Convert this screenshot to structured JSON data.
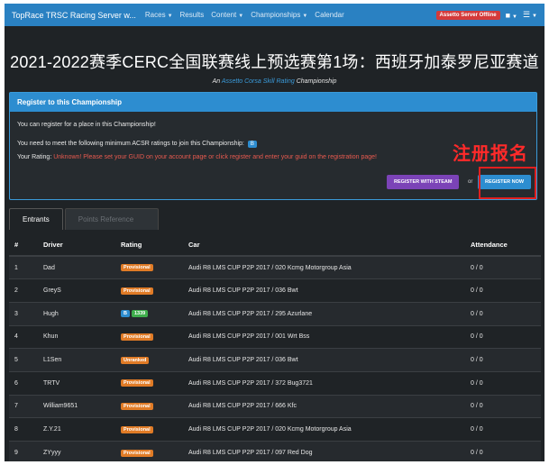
{
  "navbar": {
    "brand": "TopRace TRSC Racing Server w...",
    "items": [
      {
        "label": "Races",
        "dropdown": true
      },
      {
        "label": "Results",
        "dropdown": false
      },
      {
        "label": "Content",
        "dropdown": true
      },
      {
        "label": "Championships",
        "dropdown": true
      },
      {
        "label": "Calendar",
        "dropdown": false
      }
    ],
    "server_status": "Assetto Server Offline",
    "user_icon": "user-icon",
    "menu_icon": "menu-icon"
  },
  "page": {
    "title": "2021-2022赛季CERC全国联赛线上预选赛第1场：西班牙加泰罗尼亚赛道",
    "subtitle_prefix": "An",
    "subtitle_link": "Assetto Corsa Skill Rating",
    "subtitle_suffix": "Championship"
  },
  "register_panel": {
    "heading": "Register to this Championship",
    "line1": "You can register for a place in this Championship!",
    "line2": "You need to meet the following minimum ACSR ratings to join this Championship:",
    "required_rating": "B",
    "your_rating_label": "Your Rating:",
    "your_rating_warning": "Unknown! Please set your GUID on your account page or click register and enter your guid on the registration page!",
    "steam_button": "REGISTER WITH STEAM",
    "or_text": "or",
    "register_button": "REGISTER NOW"
  },
  "annotation": {
    "text": "注册报名",
    "color": "#ff2a2a"
  },
  "tabs": [
    {
      "label": "Entrants",
      "active": true
    },
    {
      "label": "Points Reference",
      "active": false
    }
  ],
  "table": {
    "headers": [
      "#",
      "Driver",
      "Rating",
      "Car",
      "Attendance"
    ],
    "rows": [
      {
        "num": "1",
        "driver": "Dad",
        "rating": "Provisional",
        "rating_extra": "",
        "car": "Audi R8 LMS CUP P2P 2017 / 020 Kcmg Motorgroup Asia",
        "attendance": "0 / 0"
      },
      {
        "num": "2",
        "driver": "GreyS",
        "rating": "Provisional",
        "rating_extra": "",
        "car": "Audi R8 LMS CUP P2P 2017 / 036 Bwt",
        "attendance": "0 / 0"
      },
      {
        "num": "3",
        "driver": "Hugh",
        "rating": "B",
        "rating_extra": "1339",
        "car": "Audi R8 LMS CUP P2P 2017 / 295 Azurlane",
        "attendance": "0 / 0"
      },
      {
        "num": "4",
        "driver": "Khun",
        "rating": "Provisional",
        "rating_extra": "",
        "car": "Audi R8 LMS CUP P2P 2017 / 001 Wrt Bss",
        "attendance": "0 / 0"
      },
      {
        "num": "5",
        "driver": "L1Sen",
        "rating": "Unranked",
        "rating_extra": "",
        "car": "Audi R8 LMS CUP P2P 2017 / 036 Bwt",
        "attendance": "0 / 0"
      },
      {
        "num": "6",
        "driver": "TRTV",
        "rating": "Provisional",
        "rating_extra": "",
        "car": "Audi R8 LMS CUP P2P 2017 / 372 Bug3721",
        "attendance": "0 / 0"
      },
      {
        "num": "7",
        "driver": "William9651",
        "rating": "Provisional",
        "rating_extra": "",
        "car": "Audi R8 LMS CUP P2P 2017 / 666 Kfc",
        "attendance": "0 / 0"
      },
      {
        "num": "8",
        "driver": "Z.Y.21",
        "rating": "Provisional",
        "rating_extra": "",
        "car": "Audi R8 LMS CUP P2P 2017 / 020 Kcmg Motorgroup Asia",
        "attendance": "0 / 0"
      },
      {
        "num": "9",
        "driver": "ZYyyy",
        "rating": "Provisional",
        "rating_extra": "",
        "car": "Audi R8 LMS CUP P2P 2017 / 097 Red Dog",
        "attendance": "0 / 0"
      }
    ]
  }
}
